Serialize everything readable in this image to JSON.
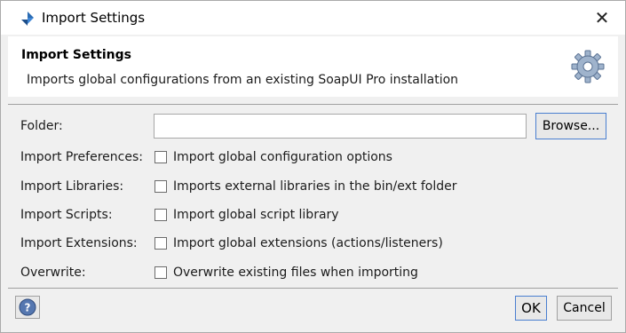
{
  "window": {
    "title": "Import Settings",
    "app_icon": "soapui-logo-icon",
    "close_label": "✕"
  },
  "header": {
    "title": "Import Settings",
    "description": "Imports global configurations from an existing SoapUI Pro installation",
    "icon": "gear-icon"
  },
  "form": {
    "folder": {
      "label": "Folder:",
      "value": "",
      "placeholder": "",
      "browse_label": "Browse..."
    },
    "rows": [
      {
        "label": "Import Preferences:",
        "option": "Import global configuration options",
        "checked": false
      },
      {
        "label": "Import Libraries:",
        "option": "Imports external libraries in the bin/ext folder",
        "checked": false
      },
      {
        "label": "Import Scripts:",
        "option": "Import global script library",
        "checked": false
      },
      {
        "label": "Import Extensions:",
        "option": "Import global extensions (actions/listeners)",
        "checked": false
      },
      {
        "label": "Overwrite:",
        "option": "Overwrite existing files when importing",
        "checked": false
      }
    ]
  },
  "footer": {
    "help_icon": "help-icon",
    "ok_label": "OK",
    "cancel_label": "Cancel"
  },
  "colors": {
    "accent_border": "#4a7fd0",
    "header_bg": "#ffffff",
    "panel_bg": "#f0f0f0"
  }
}
